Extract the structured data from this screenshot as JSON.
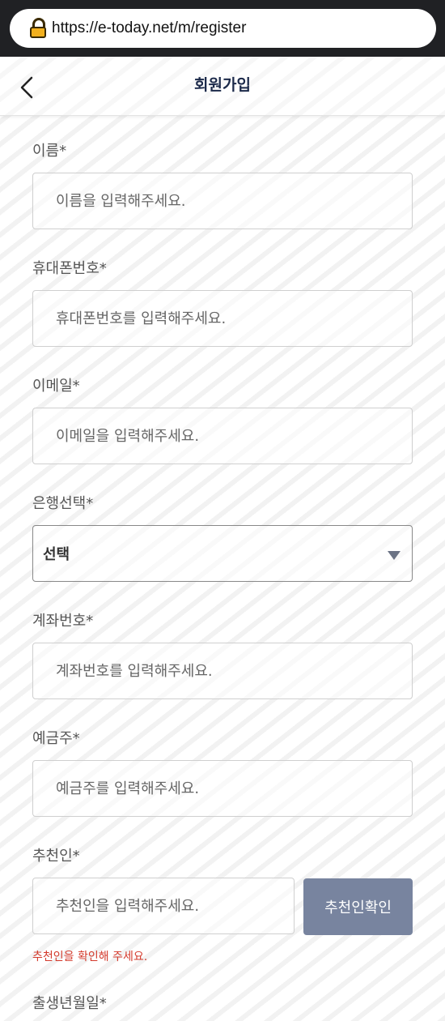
{
  "browser": {
    "url": "https://e-today.net/m/register"
  },
  "header": {
    "title": "회원가입"
  },
  "form": {
    "name": {
      "label": "이름*",
      "placeholder": "이름을 입력해주세요."
    },
    "phone": {
      "label": "휴대폰번호*",
      "placeholder": "휴대폰번호를 입력해주세요."
    },
    "email": {
      "label": "이메일*",
      "placeholder": "이메일을 입력해주세요."
    },
    "bank": {
      "label": "은행선택*",
      "selected": "선택"
    },
    "account": {
      "label": "계좌번호*",
      "placeholder": "계좌번호를 입력해주세요."
    },
    "holder": {
      "label": "예금주*",
      "placeholder": "예금주를 입력해주세요."
    },
    "referrer": {
      "label": "추천인*",
      "placeholder": "추천인을 입력해주세요.",
      "button": "추천인확인",
      "error": "추천인을 확인해 주세요."
    },
    "birth": {
      "label": "출생년월일*"
    }
  }
}
